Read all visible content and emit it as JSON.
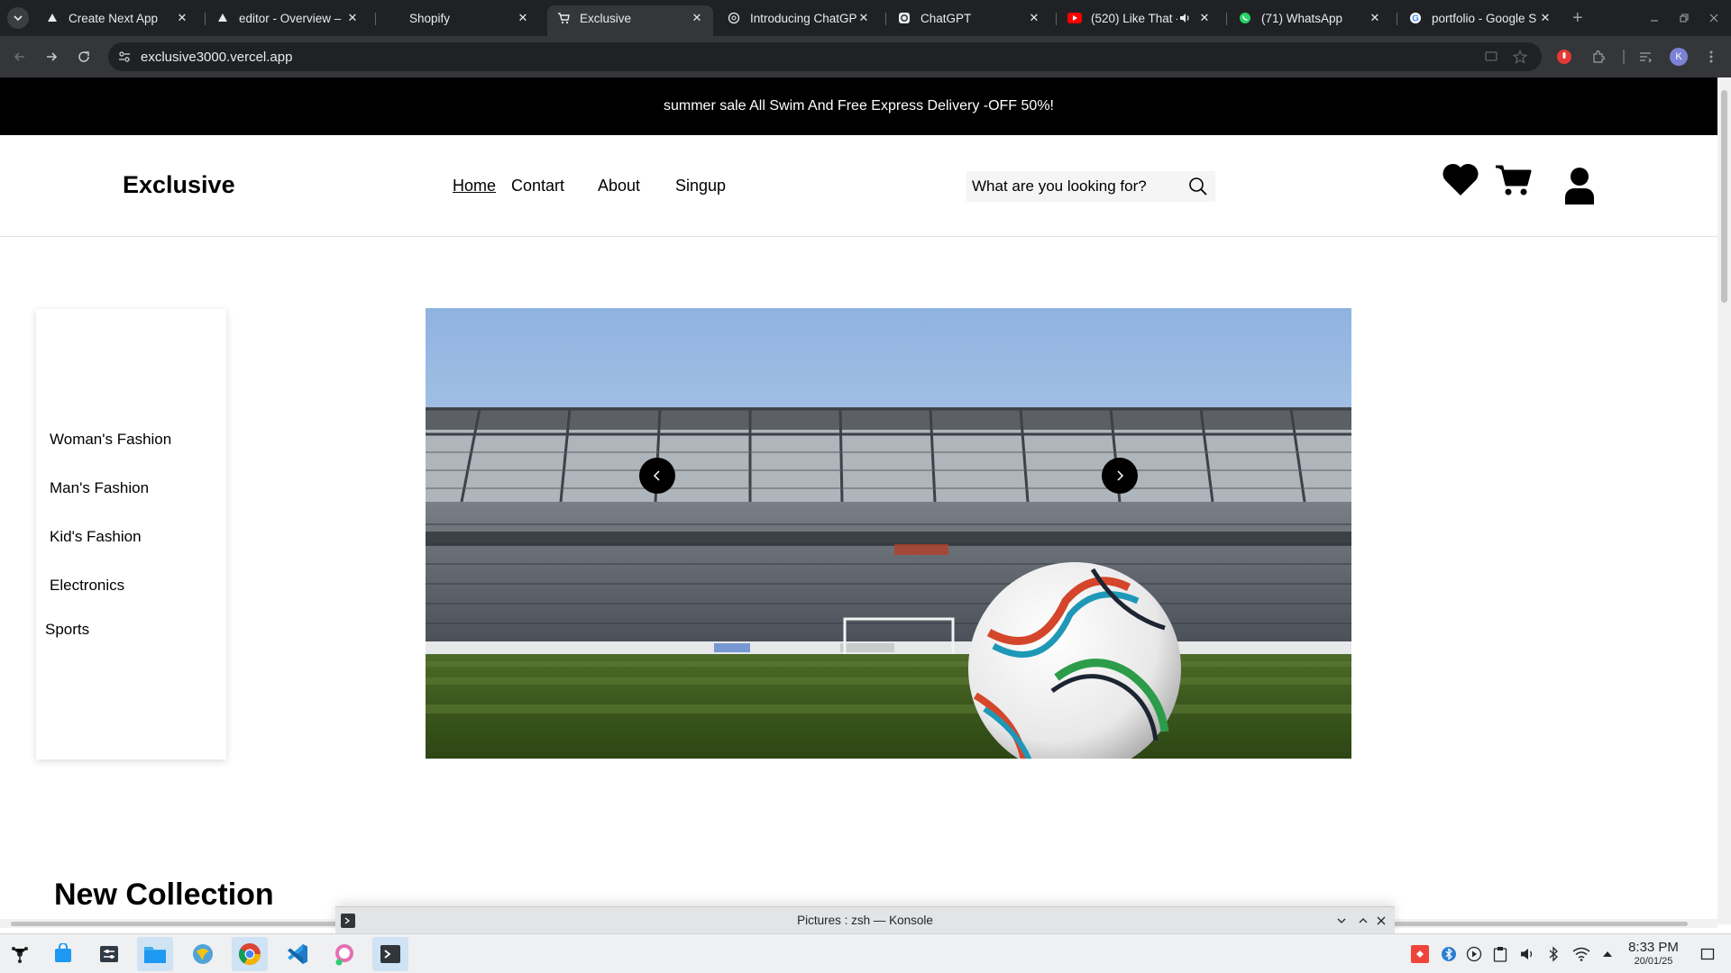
{
  "browser": {
    "tabs": [
      {
        "title": "Create Next App",
        "favicon": "vercel-icon"
      },
      {
        "title": "editor - Overview –",
        "favicon": "vercel-icon"
      },
      {
        "title": "Shopify",
        "favicon": "none"
      },
      {
        "title": "Exclusive",
        "favicon": "cart-icon",
        "active": true
      },
      {
        "title": "Introducing ChatGPT",
        "favicon": "openai-icon"
      },
      {
        "title": "ChatGPT",
        "favicon": "openai-icon"
      },
      {
        "title": "(520) Like That -",
        "favicon": "youtube-icon",
        "audio": true
      },
      {
        "title": "(71) WhatsApp",
        "favicon": "whatsapp-icon"
      },
      {
        "title": "portfolio - Google S",
        "favicon": "google-icon"
      }
    ],
    "url": "exclusive3000.vercel.app",
    "profile_initial": "K"
  },
  "page": {
    "announcement": "summer sale All Swim And Free Express Delivery -OFF 50%!",
    "logo": "Exclusive",
    "nav": [
      "Home",
      "Contart",
      "About",
      "Singup"
    ],
    "search_placeholder": "What are you looking for?",
    "categories": [
      "Woman's Fashion",
      "Man's Fashion",
      "Kid's Fashion",
      "Electronics",
      "Sports"
    ],
    "hero_image": "stadium-soccer-ball",
    "section_title": "New Collection",
    "colors": {
      "announcement_bg": "#000000",
      "search_bg": "#F5F5F5",
      "arrow_bg": "#000000"
    }
  },
  "konsole": {
    "title": "Pictures : zsh — Konsole"
  },
  "taskbar": {
    "apps": [
      "app-launcher",
      "discover-store",
      "system-settings",
      "file-manager",
      "web-browser",
      "chrome",
      "vscode",
      "media-app",
      "konsole"
    ],
    "time": "8:33 PM",
    "date": "20/01/25"
  }
}
